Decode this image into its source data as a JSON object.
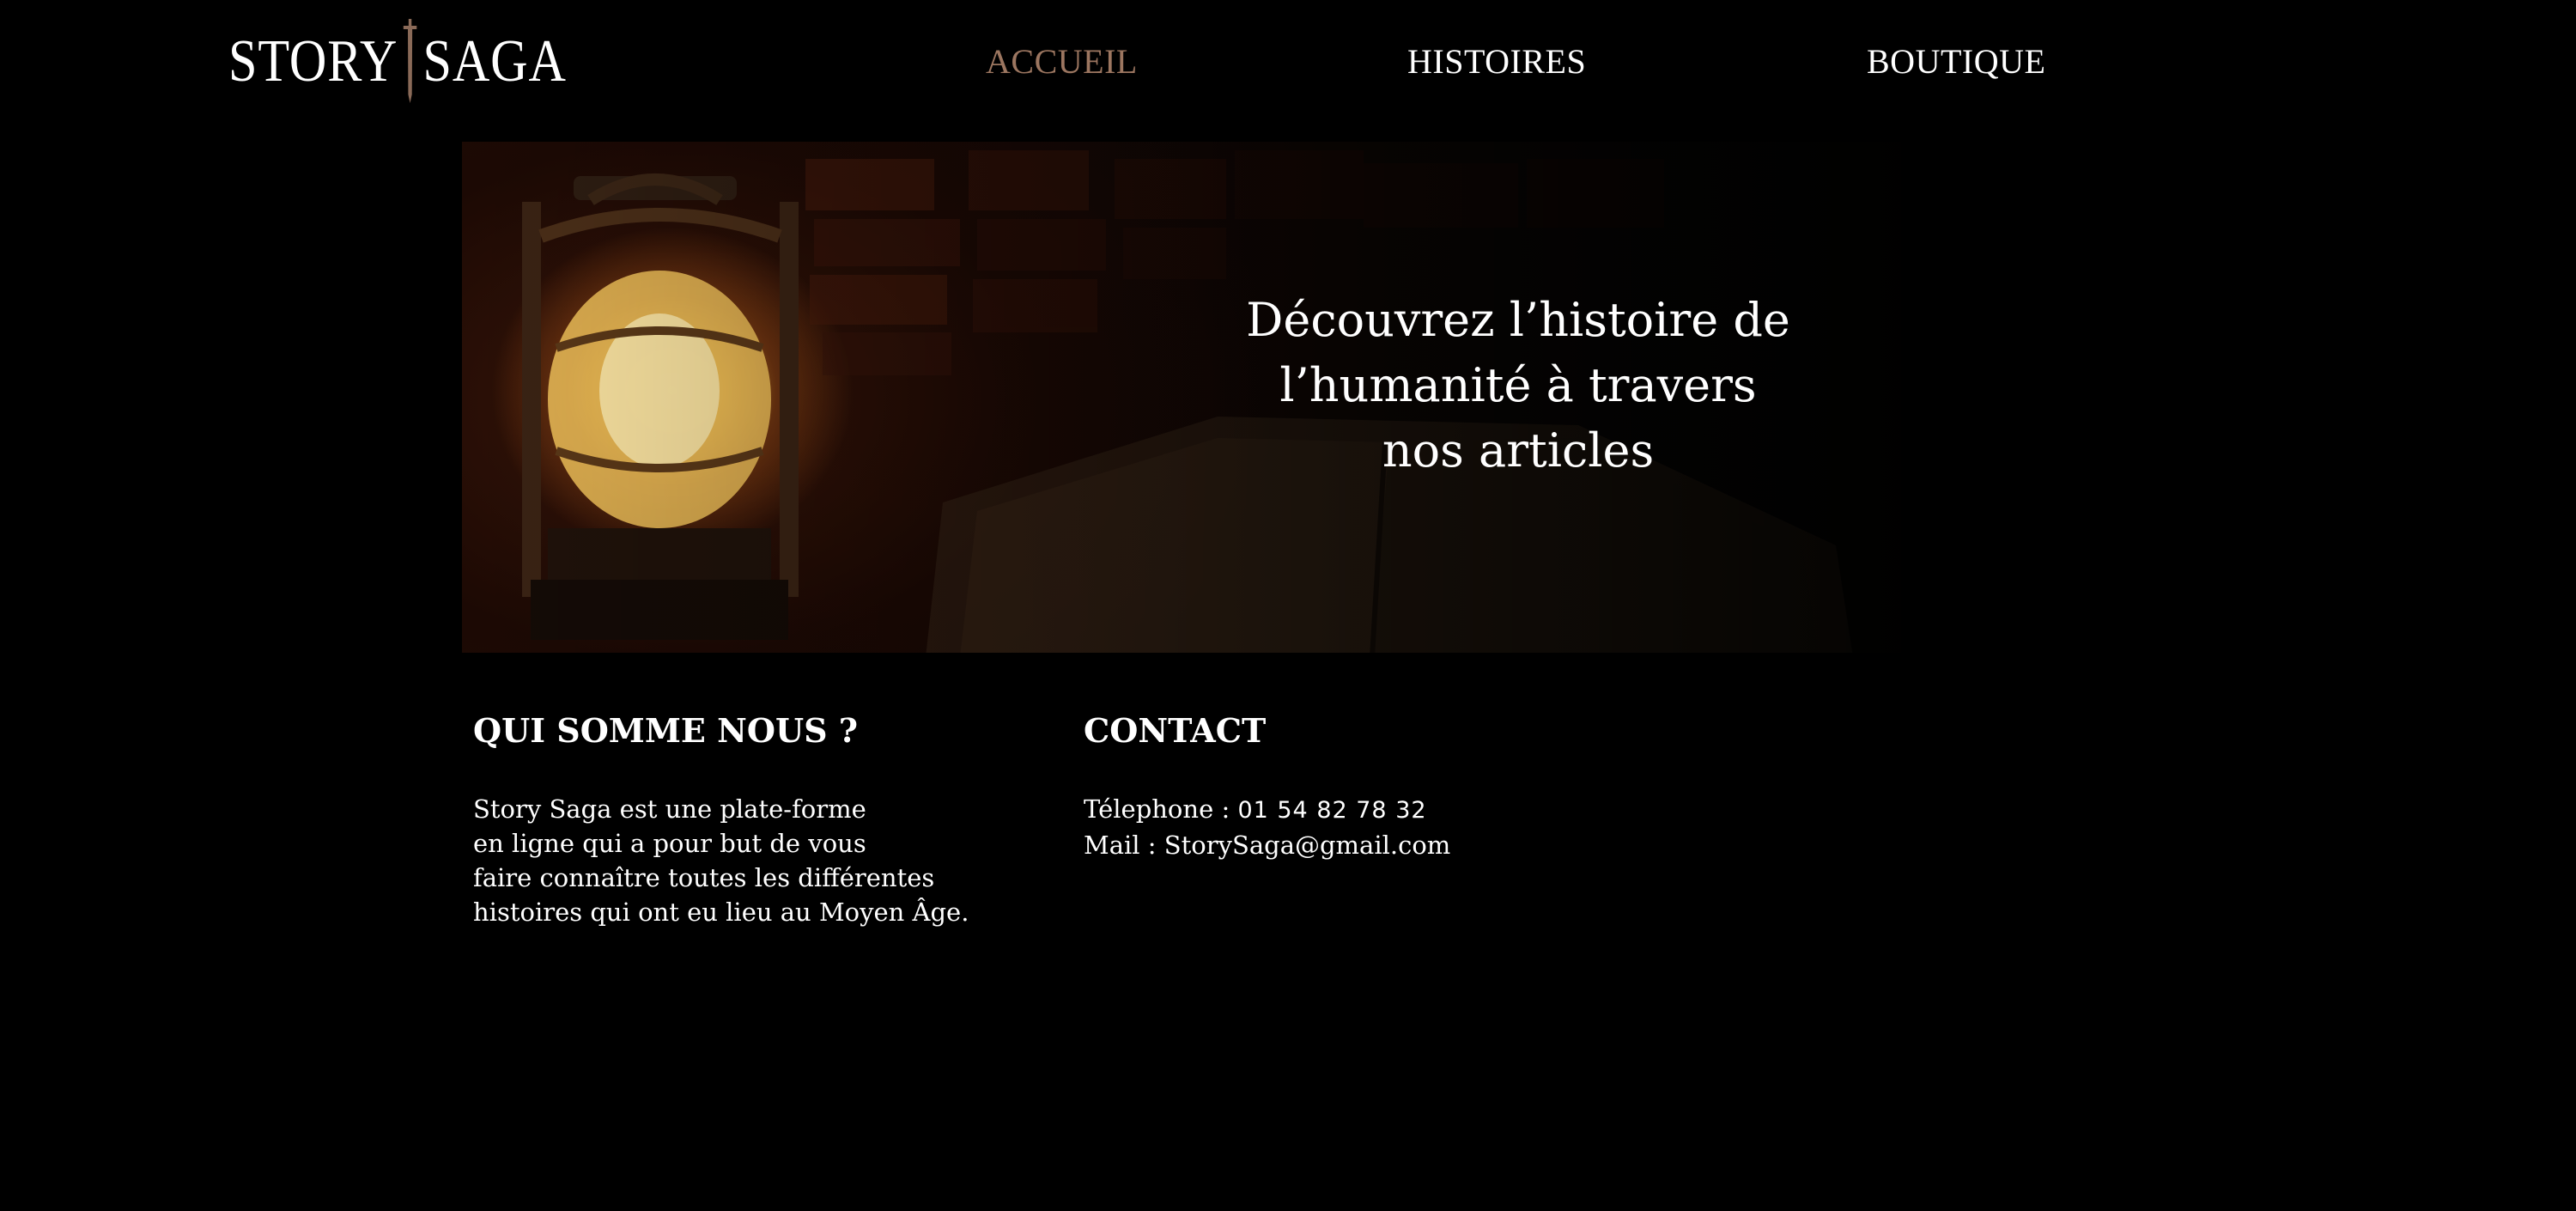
{
  "header": {
    "logo_left": "STORY",
    "logo_right": "SAGA",
    "nav": [
      {
        "label": "ACCUEIL",
        "active": true
      },
      {
        "label": "HISTOIRES",
        "active": false
      },
      {
        "label": "BOUTIQUE",
        "active": false
      }
    ]
  },
  "hero": {
    "title_lines": [
      "Découvrez l’histoire de",
      "l’humanité à travers",
      "nos articles"
    ]
  },
  "about": {
    "heading": "QUI SOMME NOUS ?",
    "lines": [
      "Story Saga est une plate-forme",
      "en ligne qui a pour but de vous",
      "faire connaître toutes les différentes",
      "histoires qui ont eu lieu au Moyen Âge."
    ]
  },
  "contact": {
    "heading": "CONTACT",
    "phone_label": "Télephone : ",
    "phone_value": "01 54 82 78 32",
    "mail_label": "Mail : ",
    "mail_value": "StorySaga@gmail.com"
  },
  "colors": {
    "background": "#000000",
    "text": "#ffffff",
    "nav_active": "#9c7660",
    "sword": "#8a6a58"
  }
}
